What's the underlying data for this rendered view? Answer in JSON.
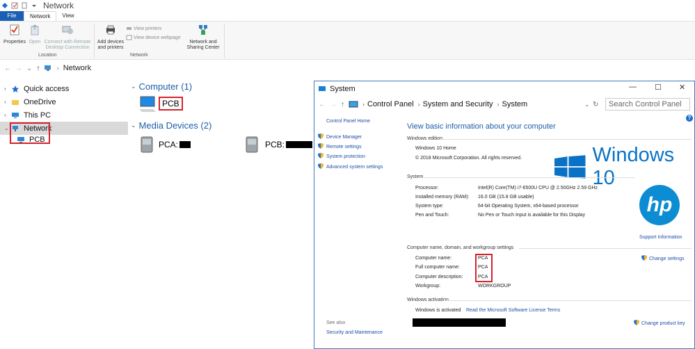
{
  "explorer": {
    "title": "Network",
    "tabs": [
      "File",
      "Network",
      "View"
    ],
    "ribbon": {
      "properties": "Properties",
      "open": "Open",
      "connect_line1": "Connect with Remote",
      "connect_line2": "Desktop Connection",
      "add_line1": "Add devices",
      "add_line2": "and printers",
      "view_printers": "View printers",
      "view_webpage": "View device webpage",
      "nsc_line1": "Network and",
      "nsc_line2": "Sharing Center",
      "group_location": "Location",
      "group_network": "Network"
    },
    "address": "Network",
    "nav": {
      "quick_access": "Quick access",
      "onedrive": "OneDrive",
      "this_pc": "This PC",
      "network": "Network",
      "pcb": "PCB"
    },
    "content": {
      "computer_header": "Computer (1)",
      "computer_item": "PCB",
      "media_header": "Media Devices (2)",
      "media_1": "PCA:",
      "media_2": "PCB:"
    }
  },
  "system": {
    "title": "System",
    "breadcrumb": [
      "Control Panel",
      "System and Security",
      "System"
    ],
    "search_placeholder": "Search Control Panel",
    "left": {
      "home": "Control Panel Home",
      "links": [
        "Device Manager",
        "Remote settings",
        "System protection",
        "Advanced system settings"
      ],
      "see_also": "See also",
      "security": "Security and Maintenance"
    },
    "heading": "View basic information about your computer",
    "edition": {
      "label": "Windows edition",
      "name": "Windows 10 Home",
      "copyright": "© 2018 Microsoft Corporation. All rights reserved."
    },
    "logo_text": "Windows 10",
    "hp_text": "hp",
    "support": "Support Information",
    "specs": {
      "label": "System",
      "rows": [
        {
          "k": "Processor:",
          "v": "Intel(R) Core(TM) i7-6500U CPU @ 2.50GHz   2.59 GHz"
        },
        {
          "k": "Installed memory (RAM):",
          "v": "16.0 GB (15.8 GB usable)"
        },
        {
          "k": "System type:",
          "v": "64-bit Operating System, x64-based processor"
        },
        {
          "k": "Pen and Touch:",
          "v": "No Pen or Touch Input is available for this Display"
        }
      ]
    },
    "names": {
      "label": "Computer name, domain, and workgroup settings",
      "rows": [
        {
          "k": "Computer name:",
          "v": "PCA"
        },
        {
          "k": "Full computer name:",
          "v": "PCA"
        },
        {
          "k": "Computer description:",
          "v": "PCA"
        },
        {
          "k": "Workgroup:",
          "v": "WORKGROUP"
        }
      ],
      "change": "Change settings"
    },
    "activation": {
      "label": "Windows activation",
      "status": "Windows is activated",
      "license": "Read the Microsoft Software License Terms",
      "change_key": "Change product key"
    }
  }
}
